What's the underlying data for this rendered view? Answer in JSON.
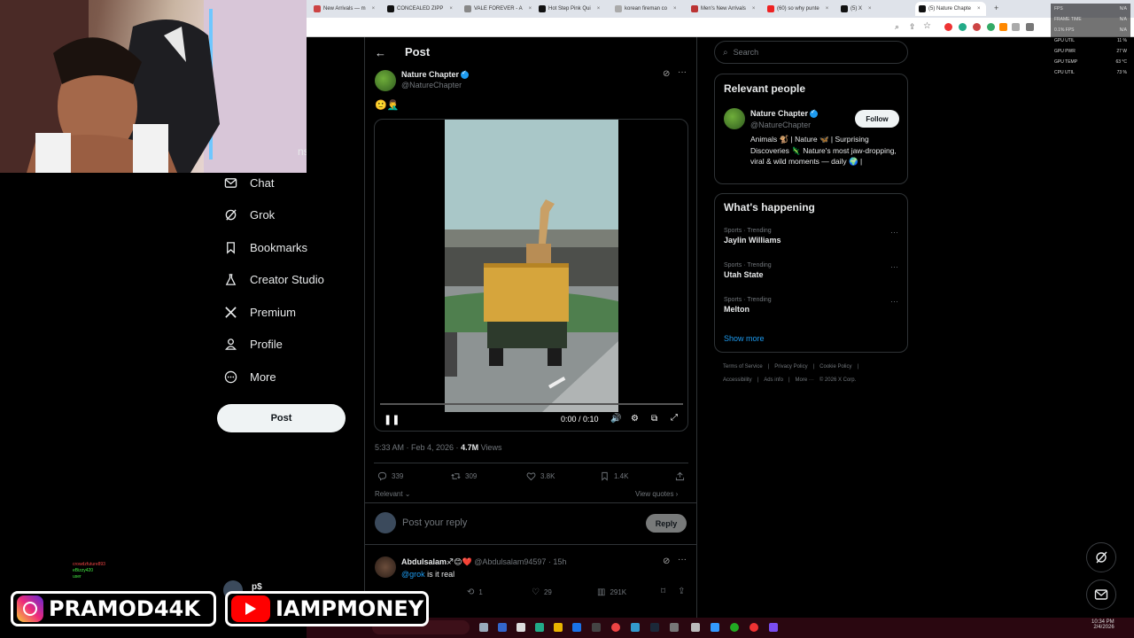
{
  "browser": {
    "tabs": [
      {
        "label": "New Arrivals — m",
        "color": "#c44"
      },
      {
        "label": "CONCEALED ZIPP",
        "color": "#111"
      },
      {
        "label": "VALE FOREVER - A",
        "color": "#888"
      },
      {
        "label": "Hot Step Pink Qui",
        "color": "#111"
      },
      {
        "label": "korean fireman co",
        "color": "#aaa"
      },
      {
        "label": "Men's New Arrivals",
        "color": "#b33"
      },
      {
        "label": "(60) so why punte",
        "color": "#e22"
      },
      {
        "label": "(5) X",
        "color": "#111"
      },
      {
        "label": "(5) Nature Chapte",
        "color": "#111"
      }
    ]
  },
  "perf_overlay": {
    "rows": [
      {
        "label": "FPS",
        "value": "N/A"
      },
      {
        "label": "FRAME TIME",
        "value": "N/A"
      },
      {
        "label": "0.1% FPS",
        "value": "N/A"
      },
      {
        "label": "GPU UTIL",
        "value": "11 %"
      },
      {
        "label": "GPU PWR",
        "value": "27 W"
      },
      {
        "label": "GPU TEMP",
        "value": "63 °C"
      },
      {
        "label": "CPU UTIL",
        "value": "73 %"
      }
    ]
  },
  "nav": {
    "partial_label": "ns",
    "items": [
      {
        "label": "Chat",
        "icon": "mail-icon"
      },
      {
        "label": "Grok",
        "icon": "grok-icon"
      },
      {
        "label": "Bookmarks",
        "icon": "bookmark-icon"
      },
      {
        "label": "Creator Studio",
        "icon": "flask-icon"
      },
      {
        "label": "Premium",
        "icon": "x-logo-icon"
      },
      {
        "label": "Profile",
        "icon": "person-icon"
      },
      {
        "label": "More",
        "icon": "more-circle-icon"
      }
    ],
    "post_label": "Post",
    "account_partial": "p$"
  },
  "post": {
    "header_title": "Post",
    "author_name": "Nature Chapter",
    "author_handle": "@NatureChapter",
    "body_emoji": "🙂🤦‍♂️",
    "video": {
      "time": "0:00 / 0:10",
      "progress": 0.0
    },
    "timestamp": "5:33 AM · Feb 4, 2026 · ",
    "views_count": "4.7M",
    "views_label": "Views",
    "stats": {
      "replies": "339",
      "reposts": "309",
      "likes": "3.8K",
      "bookmarks": "1.4K"
    },
    "sort_label": "Relevant",
    "view_quotes": "View quotes",
    "reply_placeholder": "Post your reply",
    "reply_button": "Reply"
  },
  "reply": {
    "author_name": "Abdulsalam",
    "author_emoji": "♐😊❤️",
    "author_handle": "@Abdulsalam94597 · 15h",
    "mention": "@grok",
    "text": " is it real",
    "stats": {
      "reposts": "1",
      "likes": "29",
      "views": "291K"
    }
  },
  "sidebar": {
    "search_placeholder": "Search",
    "relevant_title": "Relevant people",
    "person_name": "Nature Chapter",
    "person_handle": "@NatureChapter",
    "follow_label": "Follow",
    "person_bio": "Animals 🐒 | Nature 🦋 | Surprising Discoveries 🦎 Nature's most jaw-dropping, viral & wild moments — daily 🌍 |",
    "happening_title": "What's happening",
    "trends": [
      {
        "category": "Sports · Trending",
        "name": "Jaylin Williams"
      },
      {
        "category": "Sports · Trending",
        "name": "Utah State"
      },
      {
        "category": "Sports · Trending",
        "name": "Melton"
      }
    ],
    "show_more": "Show more",
    "footer_line1": [
      "Terms of Service",
      "|",
      "Privacy Policy",
      "|",
      "Cookie Policy",
      "|"
    ],
    "footer_line2": [
      "Accessibility",
      "|",
      "Ads info",
      "|",
      "More ···",
      "© 2026 X Corp."
    ]
  },
  "taskbar": {
    "time": "10:34 PM",
    "date": "2/4/2026"
  },
  "stream": {
    "instagram_handle": "PRAMOD44K",
    "youtube_handle": "IAMPMONEY",
    "chat_lines": [
      "crowdzfuture893",
      "eBizzy420",
      "user"
    ]
  },
  "colors": {
    "accent": "#1d9bf0",
    "background": "#000000",
    "border": "#2f3336",
    "muted": "#71767b"
  }
}
